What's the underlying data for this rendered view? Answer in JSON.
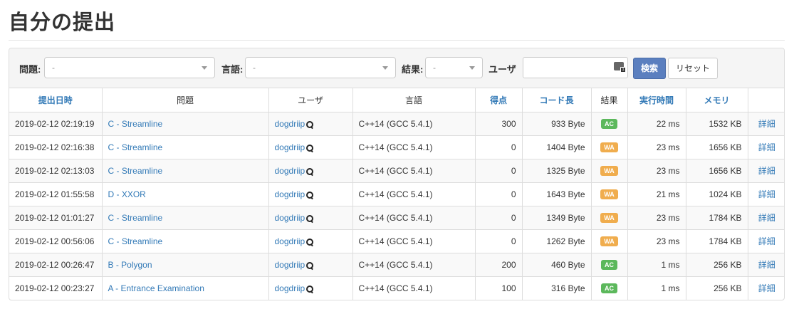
{
  "page_title": "自分の提出",
  "filters": {
    "problem_label": "問題:",
    "problem_value": "-",
    "language_label": "言語:",
    "language_value": "-",
    "result_label": "結果:",
    "result_value": "-",
    "user_label": "ユーザ",
    "user_value": "",
    "search_button": "検索",
    "reset_button": "リセット"
  },
  "table": {
    "headers": [
      "提出日時",
      "問題",
      "ユーザ",
      "言語",
      "得点",
      "コード長",
      "結果",
      "実行時間",
      "メモリ",
      ""
    ],
    "rows": [
      {
        "time": "2019-02-12 02:19:19",
        "problem": "C - Streamline",
        "user": "dogdriip",
        "lang": "C++14 (GCC 5.4.1)",
        "score": "300",
        "len": "933 Byte",
        "status": "AC",
        "exec": "22 ms",
        "mem": "1532 KB",
        "detail": "詳細"
      },
      {
        "time": "2019-02-12 02:16:38",
        "problem": "C - Streamline",
        "user": "dogdriip",
        "lang": "C++14 (GCC 5.4.1)",
        "score": "0",
        "len": "1404 Byte",
        "status": "WA",
        "exec": "23 ms",
        "mem": "1656 KB",
        "detail": "詳細"
      },
      {
        "time": "2019-02-12 02:13:03",
        "problem": "C - Streamline",
        "user": "dogdriip",
        "lang": "C++14 (GCC 5.4.1)",
        "score": "0",
        "len": "1325 Byte",
        "status": "WA",
        "exec": "23 ms",
        "mem": "1656 KB",
        "detail": "詳細"
      },
      {
        "time": "2019-02-12 01:55:58",
        "problem": "D - XXOR",
        "user": "dogdriip",
        "lang": "C++14 (GCC 5.4.1)",
        "score": "0",
        "len": "1643 Byte",
        "status": "WA",
        "exec": "21 ms",
        "mem": "1024 KB",
        "detail": "詳細"
      },
      {
        "time": "2019-02-12 01:01:27",
        "problem": "C - Streamline",
        "user": "dogdriip",
        "lang": "C++14 (GCC 5.4.1)",
        "score": "0",
        "len": "1349 Byte",
        "status": "WA",
        "exec": "23 ms",
        "mem": "1784 KB",
        "detail": "詳細"
      },
      {
        "time": "2019-02-12 00:56:06",
        "problem": "C - Streamline",
        "user": "dogdriip",
        "lang": "C++14 (GCC 5.4.1)",
        "score": "0",
        "len": "1262 Byte",
        "status": "WA",
        "exec": "23 ms",
        "mem": "1784 KB",
        "detail": "詳細"
      },
      {
        "time": "2019-02-12 00:26:47",
        "problem": "B - Polygon",
        "user": "dogdriip",
        "lang": "C++14 (GCC 5.4.1)",
        "score": "200",
        "len": "460 Byte",
        "status": "AC",
        "exec": "1 ms",
        "mem": "256 KB",
        "detail": "詳細"
      },
      {
        "time": "2019-02-12 00:23:27",
        "problem": "A - Entrance Examination",
        "user": "dogdriip",
        "lang": "C++14 (GCC 5.4.1)",
        "score": "100",
        "len": "316 Byte",
        "status": "AC",
        "exec": "1 ms",
        "mem": "256 KB",
        "detail": "詳細"
      }
    ]
  },
  "colors": {
    "link": "#337ab7",
    "ac": "#5cb85c",
    "wa": "#f0ad4e",
    "primary_button": "#5b7fbf"
  },
  "icons": {
    "user_search": "magnifier-icon",
    "input_keyboard": "keyboard-icon",
    "dropdown": "chevron-down-icon"
  }
}
